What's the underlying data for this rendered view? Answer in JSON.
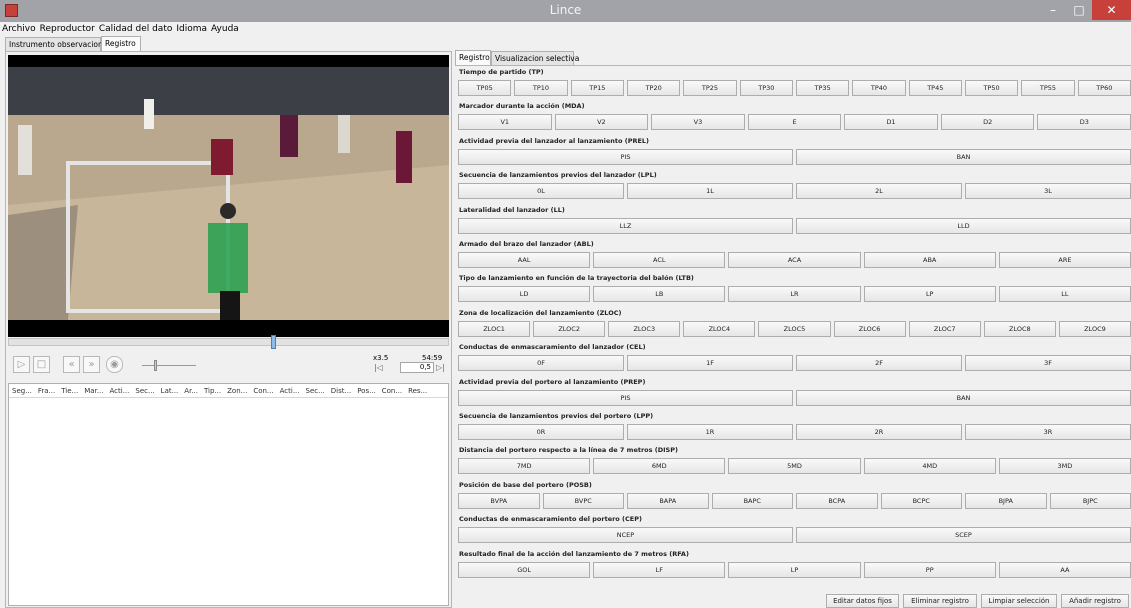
{
  "window": {
    "title": "Lince",
    "minimize_glyph": "–",
    "maximize_glyph": "□",
    "close_glyph": "✕",
    "accent_close": "#c7413a"
  },
  "menu": [
    "Archivo",
    "Reproductor",
    "Calidad del dato",
    "Idioma",
    "Ayuda"
  ],
  "main_tabs": [
    "Instrumento observacional",
    "Registro"
  ],
  "player": {
    "speed": "x3.5",
    "time": "54:59",
    "rate_value": "0,5",
    "progress": 0.6
  },
  "table_columns": [
    "Seg...",
    "Fra...",
    "Tie...",
    "Mar...",
    "Acti...",
    "Sec...",
    "Lat...",
    "Ar...",
    "Tip...",
    "Zon...",
    "Con...",
    "Acti...",
    "Sec...",
    "Dist...",
    "Pos...",
    "Con...",
    "Res..."
  ],
  "right_tabs": [
    "Registro",
    "Visualizacion selectiva"
  ],
  "groups": [
    {
      "label": "Tiempo de partido (TP)",
      "options": [
        "TP05",
        "TP10",
        "TP15",
        "TP20",
        "TP25",
        "TP30",
        "TP35",
        "TP40",
        "TP45",
        "TP50",
        "TP55",
        "TP60"
      ]
    },
    {
      "label": "Marcador durante la acción (MDA)",
      "options": [
        "V1",
        "V2",
        "V3",
        "E",
        "D1",
        "D2",
        "D3"
      ]
    },
    {
      "label": "Actividad previa del lanzador al lanzamiento (PREL)",
      "options": [
        "PIS",
        "BAN"
      ]
    },
    {
      "label": "Secuencia de lanzamientos previos del lanzador (LPL)",
      "options": [
        "0L",
        "1L",
        "2L",
        "3L"
      ]
    },
    {
      "label": "Lateralidad del lanzador (LL)",
      "options": [
        "LLZ",
        "LLD"
      ]
    },
    {
      "label": "Armado del brazo del lanzador (ABL)",
      "options": [
        "AAL",
        "ACL",
        "ACA",
        "ABA",
        "ARE"
      ]
    },
    {
      "label": "Tipo de lanzamiento en función de la trayectoria del balón (LTB)",
      "options": [
        "LD",
        "LB",
        "LR",
        "LP",
        "LL"
      ]
    },
    {
      "label": "Zona de localización del lanzamiento (ZLOC)",
      "options": [
        "ZLOC1",
        "ZLOC2",
        "ZLOC3",
        "ZLOC4",
        "ZLOC5",
        "ZLOC6",
        "ZLOC7",
        "ZLOC8",
        "ZLOC9"
      ]
    },
    {
      "label": "Conductas de enmascaramiento del lanzador (CEL)",
      "options": [
        "0F",
        "1F",
        "2F",
        "3F"
      ]
    },
    {
      "label": "Actividad previa del portero al lanzamiento (PREP)",
      "options": [
        "PIS",
        "BAN"
      ]
    },
    {
      "label": "Secuencia de lanzamientos previos del portero (LPP)",
      "options": [
        "0R",
        "1R",
        "2R",
        "3R"
      ]
    },
    {
      "label": "Distancia del portero respecto a la línea de 7 metros (DISP)",
      "options": [
        "7MD",
        "6MD",
        "5MD",
        "4MD",
        "3MD"
      ]
    },
    {
      "label": "Posición de base del portero (POSB)",
      "options": [
        "BVPA",
        "BVPC",
        "BAPA",
        "BAPC",
        "BCPA",
        "BCPC",
        "BJPA",
        "BJPC"
      ]
    },
    {
      "label": "Conductas de enmascaramiento del portero (CEP)",
      "options": [
        "NCEP",
        "SCEP"
      ]
    },
    {
      "label": "Resultado final de la acción del lanzamiento de 7 metros (RFA)",
      "options": [
        "GOL",
        "LF",
        "LP",
        "PP",
        "AA"
      ]
    }
  ],
  "actions": [
    "Editar datos fijos",
    "Eliminar registro",
    "Limpiar selección",
    "Añadir registro"
  ],
  "icons": [
    "app-icon",
    "play-icon",
    "stop-icon",
    "rewind-icon",
    "fast-forward-icon",
    "volume-icon",
    "step-back-icon",
    "step-forward-icon"
  ]
}
